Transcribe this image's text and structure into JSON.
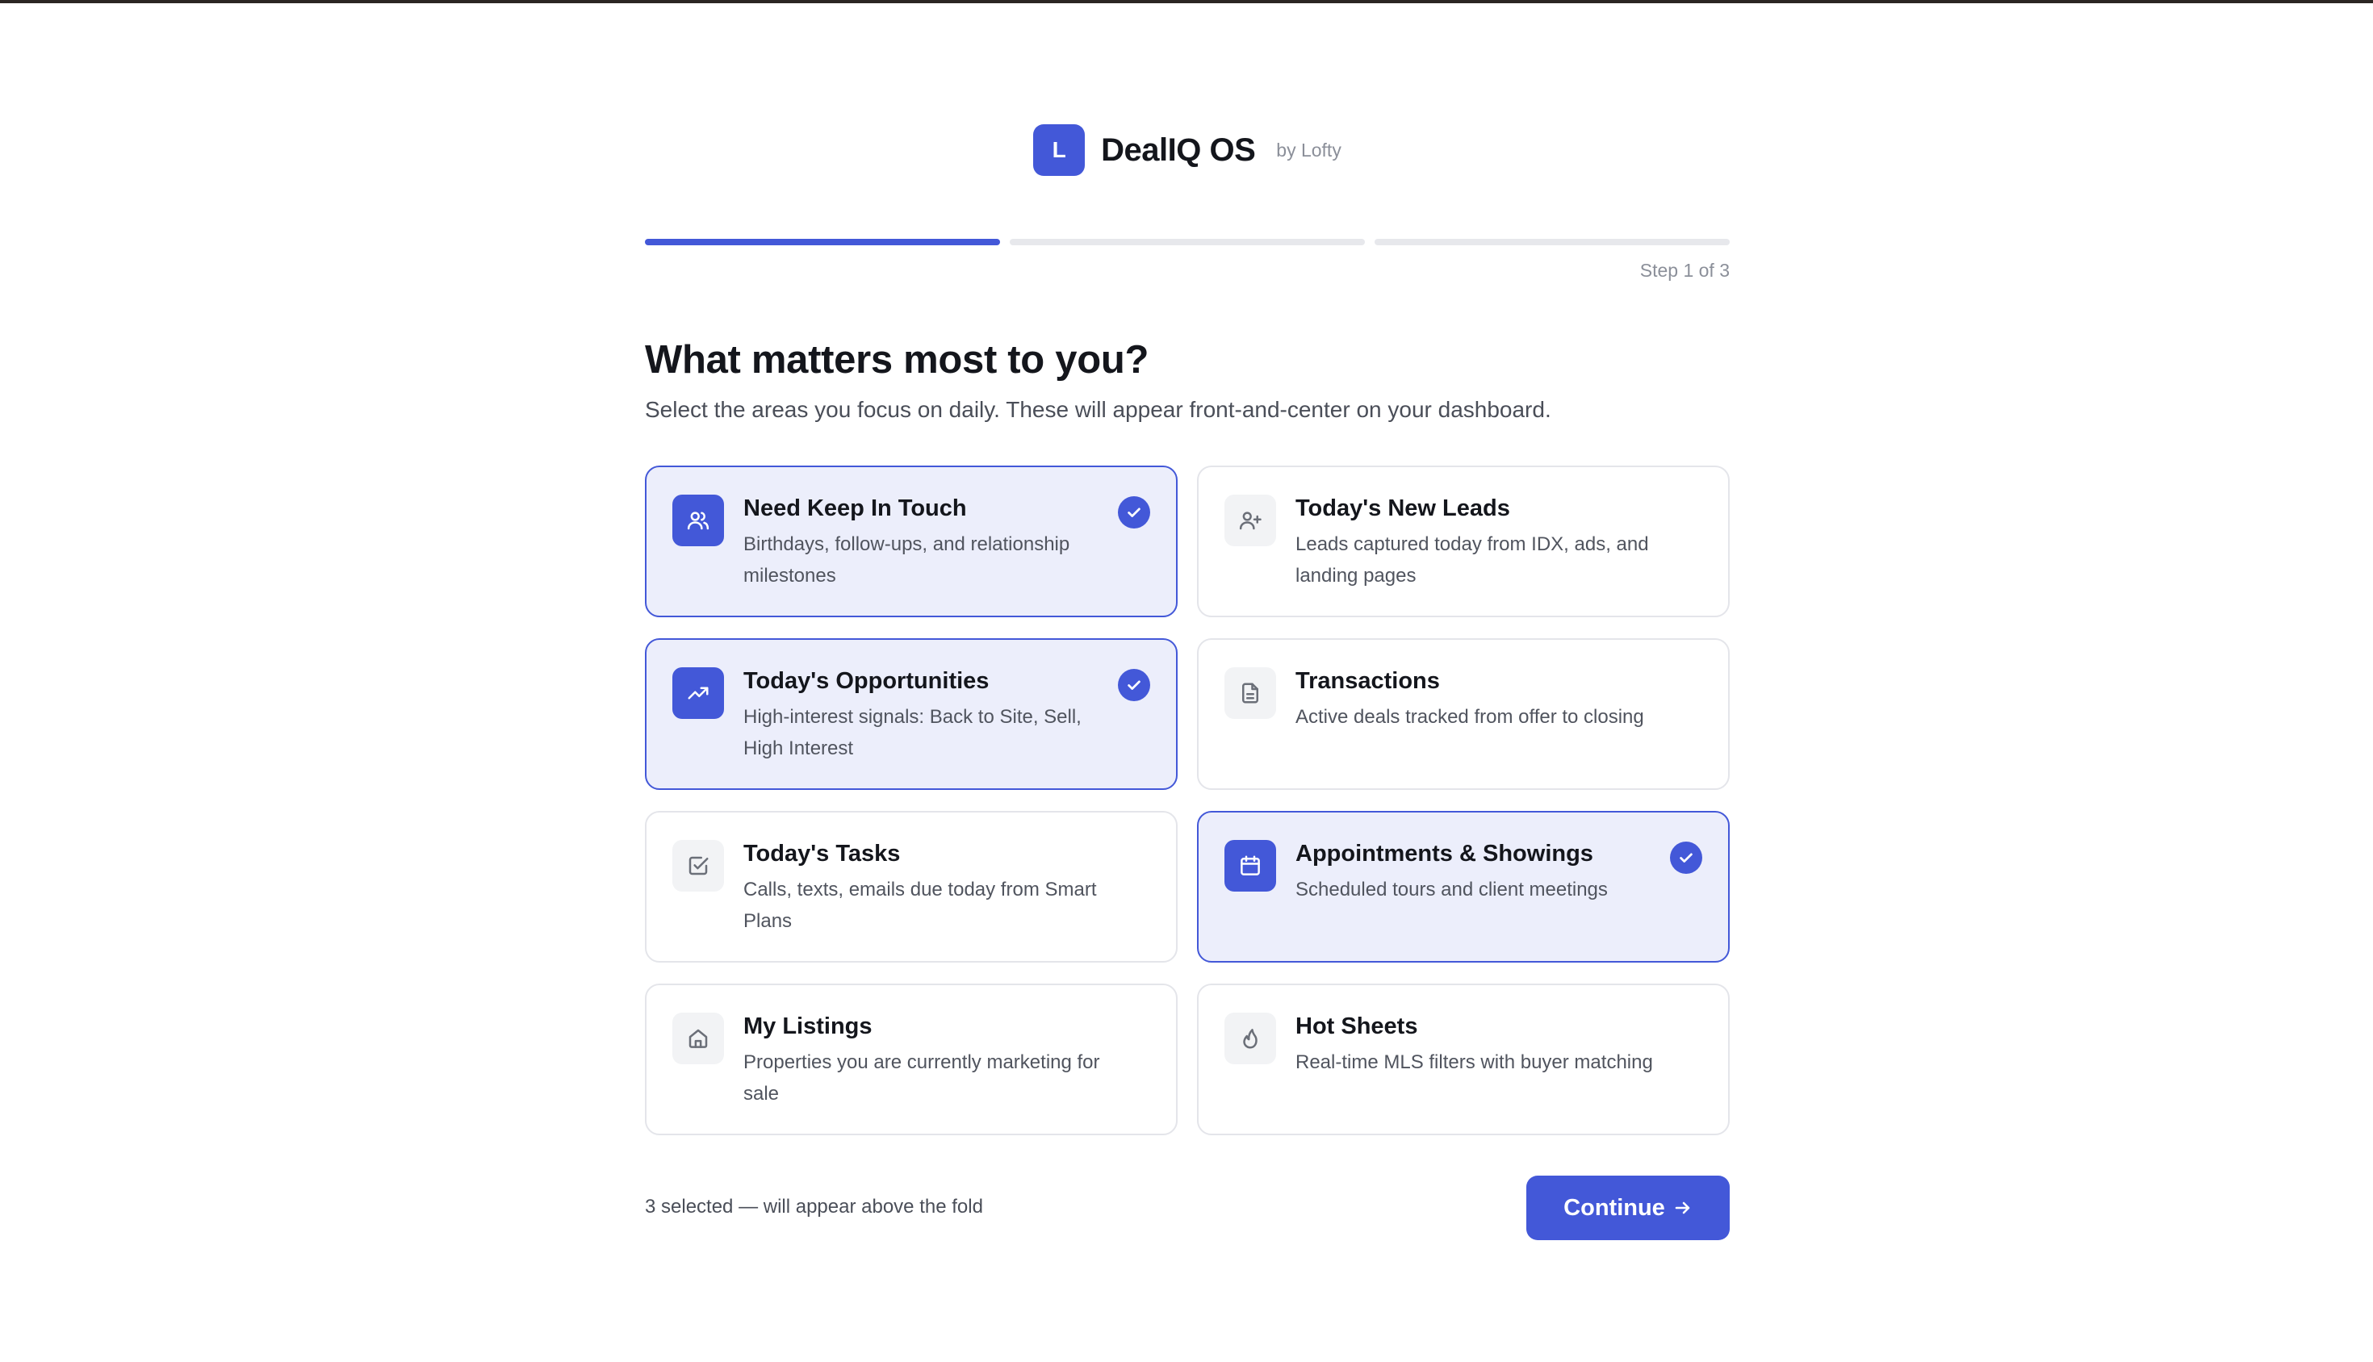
{
  "brand": {
    "logo_letter": "L",
    "name": "DealIQ OS",
    "by": "by Lofty"
  },
  "progress": {
    "current_step": 1,
    "total_steps": 3,
    "label": "Step 1 of 3"
  },
  "page": {
    "title": "What matters most to you?",
    "subtitle": "Select the areas you focus on daily. These will appear front-and-center on your dashboard."
  },
  "options": [
    {
      "title": "Need Keep In Touch",
      "description": "Birthdays, follow-ups, and relationship milestones",
      "icon": "users-icon",
      "selected": true
    },
    {
      "title": "Today's New Leads",
      "description": "Leads captured today from IDX, ads, and landing pages",
      "icon": "user-plus-icon",
      "selected": false
    },
    {
      "title": "Today's Opportunities",
      "description": "High-interest signals: Back to Site, Sell, High Interest",
      "icon": "trending-up-icon",
      "selected": true
    },
    {
      "title": "Transactions",
      "description": "Active deals tracked from offer to closing",
      "icon": "document-icon",
      "selected": false
    },
    {
      "title": "Today's Tasks",
      "description": "Calls, texts, emails due today from Smart Plans",
      "icon": "checkbox-icon",
      "selected": false
    },
    {
      "title": "Appointments & Showings",
      "description": "Scheduled tours and client meetings",
      "icon": "calendar-icon",
      "selected": true
    },
    {
      "title": "My Listings",
      "description": "Properties you are currently marketing for sale",
      "icon": "home-icon",
      "selected": false
    },
    {
      "title": "Hot Sheets",
      "description": "Real-time MLS filters with buyer matching",
      "icon": "flame-icon",
      "selected": false
    }
  ],
  "footer": {
    "selection_note": "3 selected — will appear above the fold",
    "continue_label": "Continue"
  },
  "colors": {
    "accent": "#4358d8",
    "selected_bg": "#eceefb",
    "border": "#e4e5ea"
  }
}
